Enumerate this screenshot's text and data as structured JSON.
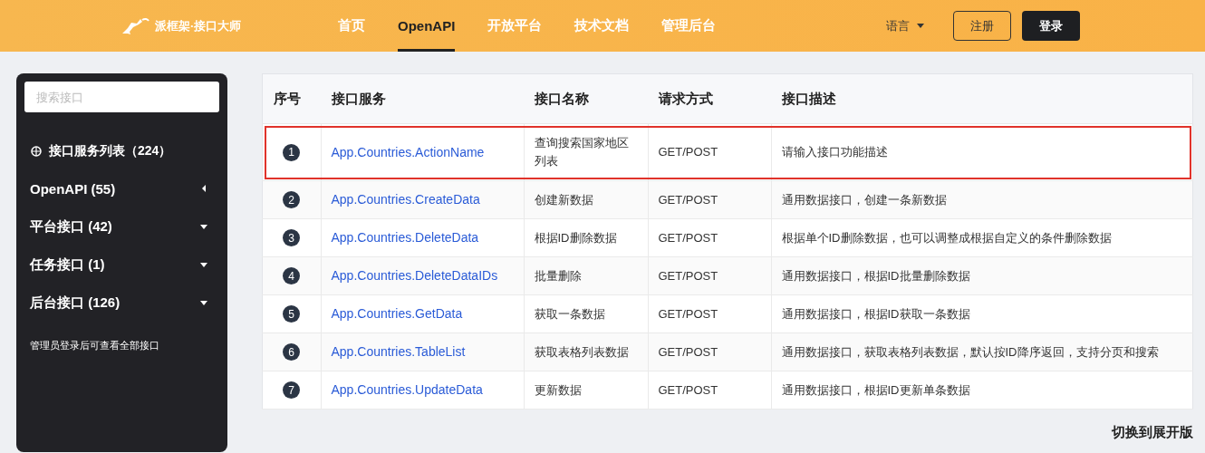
{
  "header": {
    "logo_text": "派框架·接口大师",
    "nav": [
      {
        "label": "首页",
        "selected": false
      },
      {
        "label": "OpenAPI",
        "selected": true
      },
      {
        "label": "开放平台",
        "selected": false
      },
      {
        "label": "技术文档",
        "selected": false
      },
      {
        "label": "管理后台",
        "selected": false
      }
    ],
    "language": "语言",
    "register": "注册",
    "login": "登录"
  },
  "sidebar": {
    "search": {
      "placeholder": "搜索接口"
    },
    "title": "接口服务列表（224）",
    "groups": [
      {
        "label": "OpenAPI (55)",
        "expanded": false
      },
      {
        "label": "平台接口 (42)",
        "expanded": true
      },
      {
        "label": "任务接口 (1)",
        "expanded": true
      },
      {
        "label": "后台接口 (126)",
        "expanded": true
      }
    ],
    "note": "管理员登录后可查看全部接口"
  },
  "table": {
    "columns": [
      "序号",
      "接口服务",
      "接口名称",
      "请求方式",
      "接口描述"
    ],
    "rows": [
      {
        "index": "1",
        "service": "App.Countries.ActionName",
        "name": "查询搜索国家地区列表",
        "method": "GET/POST",
        "description": "请输入接口功能描述",
        "highlighted": true
      },
      {
        "index": "2",
        "service": "App.Countries.CreateData",
        "name": "创建新数据",
        "method": "GET/POST",
        "description": "通用数据接口，创建一条新数据",
        "highlighted": false
      },
      {
        "index": "3",
        "service": "App.Countries.DeleteData",
        "name": "根据ID删除数据",
        "method": "GET/POST",
        "description": "根据单个ID删除数据，也可以调整成根据自定义的条件删除数据",
        "highlighted": false
      },
      {
        "index": "4",
        "service": "App.Countries.DeleteDataIDs",
        "name": "批量删除",
        "method": "GET/POST",
        "description": "通用数据接口，根据ID批量删除数据",
        "highlighted": false
      },
      {
        "index": "5",
        "service": "App.Countries.GetData",
        "name": "获取一条数据",
        "method": "GET/POST",
        "description": "通用数据接口，根据ID获取一条数据",
        "highlighted": false
      },
      {
        "index": "6",
        "service": "App.Countries.TableList",
        "name": "获取表格列表数据",
        "method": "GET/POST",
        "description": "通用数据接口，获取表格列表数据，默认按ID降序返回，支持分页和搜索",
        "highlighted": false
      },
      {
        "index": "7",
        "service": "App.Countries.UpdateData",
        "name": "更新数据",
        "method": "GET/POST",
        "description": "通用数据接口，根据ID更新单条数据",
        "highlighted": false
      }
    ]
  },
  "switch_link": "切换到展开版"
}
